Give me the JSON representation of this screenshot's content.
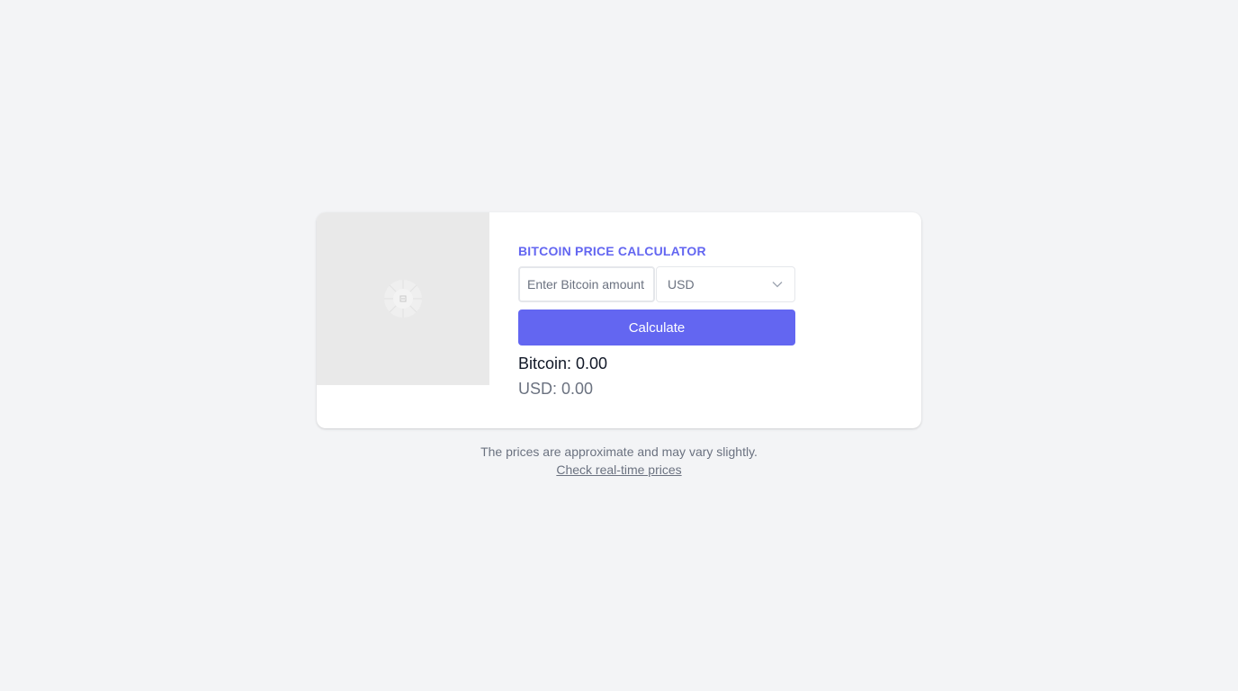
{
  "calculator": {
    "title": "BITCOIN PRICE CALCULATOR",
    "amount_placeholder": "Enter Bitcoin amount",
    "amount_value": "",
    "currency_selected": "USD",
    "calculate_label": "Calculate",
    "btc_result": "Bitcoin: 0.00",
    "fiat_result": "USD: 0.00",
    "image_icon": "image-placeholder-icon"
  },
  "footer": {
    "disclaimer": "The prices are approximate and may vary slightly.",
    "link_label": "Check real-time prices"
  },
  "colors": {
    "accent": "#6366f1",
    "background": "#f3f4f6",
    "card": "#ffffff",
    "muted_text": "#6b7280"
  }
}
